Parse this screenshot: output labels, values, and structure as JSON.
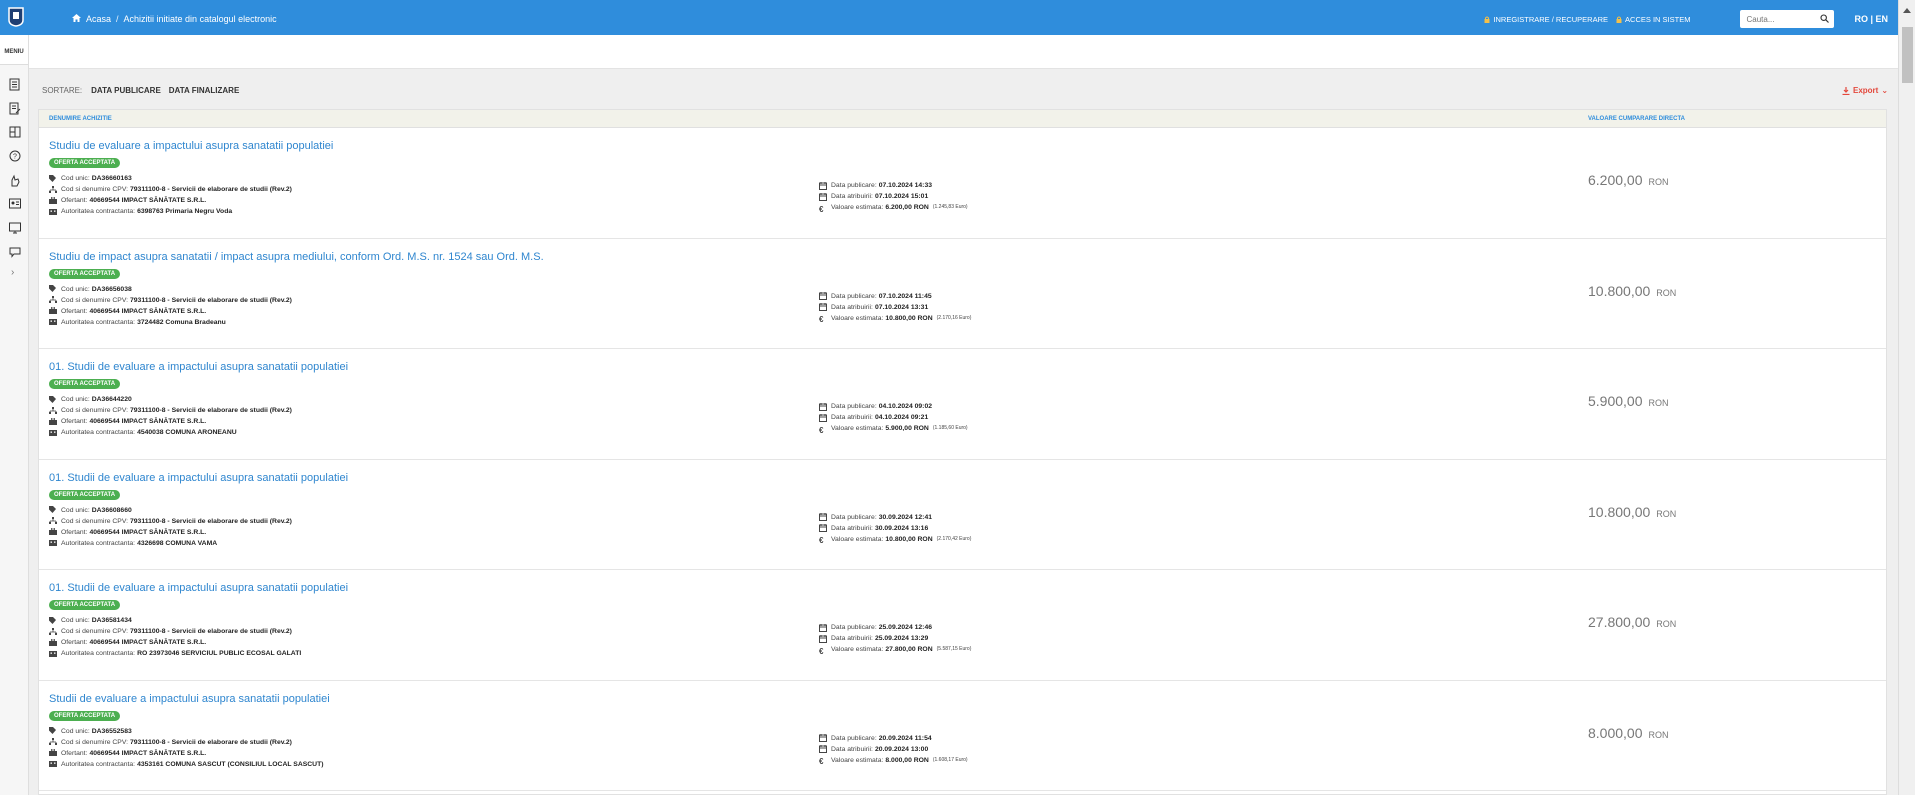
{
  "header": {
    "breadcrumb": [
      "Acasa",
      "Achizitii initiate din catalogul electronic"
    ],
    "register_label": "INREGISTRARE / RECUPERARE",
    "login_label": "ACCES IN SISTEM",
    "search_placeholder": "Cauta...",
    "language_label": "RO | EN"
  },
  "sidebar": {
    "menu_label": "MENIU",
    "icons": [
      "document-icon",
      "edit-document-icon",
      "catalog-icon",
      "help-icon",
      "hand-icon",
      "id-card-icon",
      "monitor-icon",
      "chat-icon"
    ]
  },
  "toolbar": {
    "sort_label": "SORTARE:",
    "sort_options": [
      "DATA PUBLICARE",
      "DATA FINALIZARE"
    ],
    "export_label": "Export"
  },
  "table": {
    "headers": {
      "name": "DENUMIRE ACHIZITIE",
      "value": "VALOARE CUMPARARE DIRECTA"
    },
    "labels": {
      "code": "Cod unic:",
      "cpv": "Cod si denumire CPV:",
      "bidder": "Ofertant:",
      "authority": "Autoritatea contractanta:",
      "published": "Data publicare:",
      "awarded": "Data atribuirii:",
      "estimated": "Valoare estimata:"
    },
    "rows": [
      {
        "title": "Studiu de evaluare a impactului asupra sanatatii populatiei",
        "status": "OFERTA ACCEPTATA",
        "code": "DA36660163",
        "cpv": "79311100-8 - Servicii de elaborare de studii (Rev.2)",
        "bidder": "40669544 IMPACT SĂNĂTATE S.R.L.",
        "authority": "6398763 Primaria Negru Voda",
        "published": "07.10.2024 14:33",
        "awarded": "07.10.2024 15:01",
        "estimated": "6.200,00 RON",
        "estimated_euro": "(1.245,83 Euro)",
        "value": "6.200,00",
        "currency": "RON"
      },
      {
        "title": "Studiu de impact asupra sanatatii / impact asupra mediului, conform Ord. M.S. nr. 1524 sau Ord. M.S.",
        "status": "OFERTA ACCEPTATA",
        "code": "DA36656038",
        "cpv": "79311100-8 - Servicii de elaborare de studii (Rev.2)",
        "bidder": "40669544 IMPACT SĂNĂTATE S.R.L.",
        "authority": "3724482 Comuna Bradeanu",
        "published": "07.10.2024 11:45",
        "awarded": "07.10.2024 13:31",
        "estimated": "10.800,00 RON",
        "estimated_euro": "(2.170,16 Euro)",
        "value": "10.800,00",
        "currency": "RON"
      },
      {
        "title": "01. Studii de evaluare a impactului asupra sanatatii populatiei",
        "status": "OFERTA ACCEPTATA",
        "code": "DA36644220",
        "cpv": "79311100-8 - Servicii de elaborare de studii (Rev.2)",
        "bidder": "40669544 IMPACT SĂNĂTATE S.R.L.",
        "authority": "4540038 COMUNA ARONEANU",
        "published": "04.10.2024 09:02",
        "awarded": "04.10.2024 09:21",
        "estimated": "5.900,00 RON",
        "estimated_euro": "(1.185,60 Euro)",
        "value": "5.900,00",
        "currency": "RON"
      },
      {
        "title": "01. Studii de evaluare a impactului asupra sanatatii populatiei",
        "status": "OFERTA ACCEPTATA",
        "code": "DA36608660",
        "cpv": "79311100-8 - Servicii de elaborare de studii (Rev.2)",
        "bidder": "40669544 IMPACT SĂNĂTATE S.R.L.",
        "authority": "4326698 COMUNA VAMA",
        "published": "30.09.2024 12:41",
        "awarded": "30.09.2024 13:16",
        "estimated": "10.800,00 RON",
        "estimated_euro": "(2.170,42 Euro)",
        "value": "10.800,00",
        "currency": "RON"
      },
      {
        "title": "01. Studii de evaluare a impactului asupra sanatatii populatiei",
        "status": "OFERTA ACCEPTATA",
        "code": "DA36581434",
        "cpv": "79311100-8 - Servicii de elaborare de studii (Rev.2)",
        "bidder": "40669544 IMPACT SĂNĂTATE S.R.L.",
        "authority": "RO 23973046 SERVICIUL PUBLIC ECOSAL GALATI",
        "published": "25.09.2024 12:46",
        "awarded": "25.09.2024 13:29",
        "estimated": "27.800,00 RON",
        "estimated_euro": "(5.587,15 Euro)",
        "value": "27.800,00",
        "currency": "RON"
      },
      {
        "title": "Studii de evaluare a impactului asupra sanatatii populatiei",
        "status": "OFERTA ACCEPTATA",
        "code": "DA36552583",
        "cpv": "79311100-8 - Servicii de elaborare de studii (Rev.2)",
        "bidder": "40669544 IMPACT SĂNĂTATE S.R.L.",
        "authority": "4353161 COMUNA SASCUT (CONSILIUL LOCAL SASCUT)",
        "published": "20.09.2024 11:54",
        "awarded": "20.09.2024 13:00",
        "estimated": "8.000,00 RON",
        "estimated_euro": "(1.608,17 Euro)",
        "value": "8.000,00",
        "currency": "RON"
      }
    ]
  },
  "colors": {
    "header": "#2f8ddc",
    "badge": "#4caf50",
    "export": "#e3483c",
    "title": "#2f86cf"
  }
}
